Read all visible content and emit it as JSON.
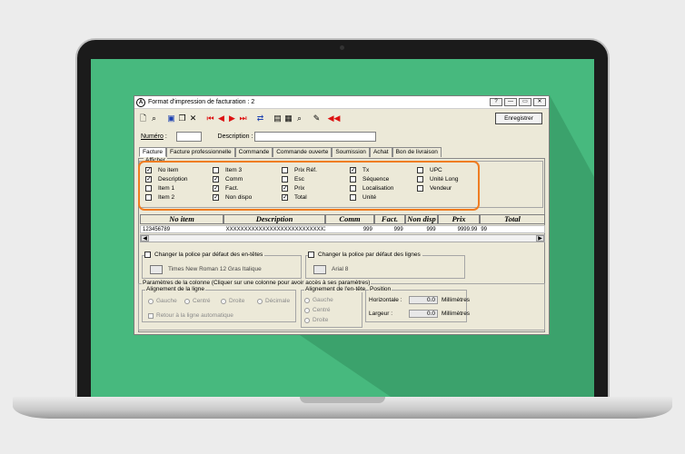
{
  "window": {
    "title": "Format d'impression de facturation : 2",
    "app_icon": "A",
    "help_btn": "?",
    "minimize_btn": "—",
    "maximize_btn": "▭",
    "close_btn": "✕"
  },
  "toolbar": {
    "icons": [
      "new-document-icon",
      "binoculars-icon",
      "save-icon",
      "copy-icon",
      "delete-icon",
      "first-record-icon",
      "previous-record-icon",
      "next-record-icon",
      "last-record-icon",
      "link-icon",
      "printer-icon",
      "print-preview-icon",
      "find-print-icon",
      "edit-icon",
      "back-icon"
    ],
    "save_label": "Enregistrer"
  },
  "form": {
    "numero_label": "Numéro",
    "numero_value": "",
    "description_label": "Description",
    "description_value": ""
  },
  "tabs": [
    "Facture",
    "Facture professionnelle",
    "Commande",
    "Commande ouverte",
    "Soumission",
    "Achat",
    "Bon de livraison"
  ],
  "afficher": {
    "title": "Afficher",
    "items": [
      {
        "label": "No item",
        "checked": true
      },
      {
        "label": "Description",
        "checked": true
      },
      {
        "label": "Item 1",
        "checked": false
      },
      {
        "label": "Item 2",
        "checked": false
      },
      {
        "label": "Item 3",
        "checked": false
      },
      {
        "label": "Comm",
        "checked": true
      },
      {
        "label": "Fact.",
        "checked": true
      },
      {
        "label": "Non dispo",
        "checked": true
      },
      {
        "label": "Prix Réf.",
        "checked": false
      },
      {
        "label": "Esc",
        "checked": false
      },
      {
        "label": "Prix",
        "checked": true
      },
      {
        "label": "Total",
        "checked": true
      },
      {
        "label": "Tx",
        "checked": true
      },
      {
        "label": "Séquence",
        "checked": false
      },
      {
        "label": "Localisation",
        "checked": false
      },
      {
        "label": "Unité",
        "checked": false
      },
      {
        "label": "UPC",
        "checked": false
      },
      {
        "label": "Unité Long",
        "checked": false
      },
      {
        "label": "Vendeur",
        "checked": false
      }
    ]
  },
  "columns": {
    "headers": [
      "No item",
      "Description",
      "Comm",
      "Fact.",
      "Non disp",
      "Prix",
      "Total"
    ],
    "row": [
      "123456789",
      "XXXXXXXXXXXXXXXXXXXXXXXXXXXXXXX",
      "999",
      "999",
      "999",
      "9999.99",
      "99"
    ]
  },
  "scroll": {
    "left": "◀",
    "right": "▶"
  },
  "font_header": {
    "label": "Changer la police par défaut des en-têtes",
    "checked": false,
    "font": "Times New Roman 12 Gras Italique"
  },
  "font_lines": {
    "label": "Changer la police par défaut des lignes",
    "checked": false,
    "font": "Arial 8"
  },
  "params": {
    "title": "Paramètres de la colonne (Cliquer sur une colonne pour avoir accès à ses paramètres)",
    "line_align": {
      "title": "Alignement de la ligne",
      "options": [
        "Gauche",
        "Centré",
        "Droite",
        "Décimale"
      ],
      "wrap_label": "Retour à la ligne automatique"
    },
    "header_align": {
      "title": "Alignement de l'en-tête",
      "options": [
        "Gauche",
        "Centré",
        "Droite"
      ]
    },
    "position": {
      "title": "Position",
      "horizontal_label": "Horizontale :",
      "horizontal_value": "0.0",
      "width_label": "Largeur :",
      "width_value": "0.0",
      "unit": "Millimètres"
    }
  }
}
